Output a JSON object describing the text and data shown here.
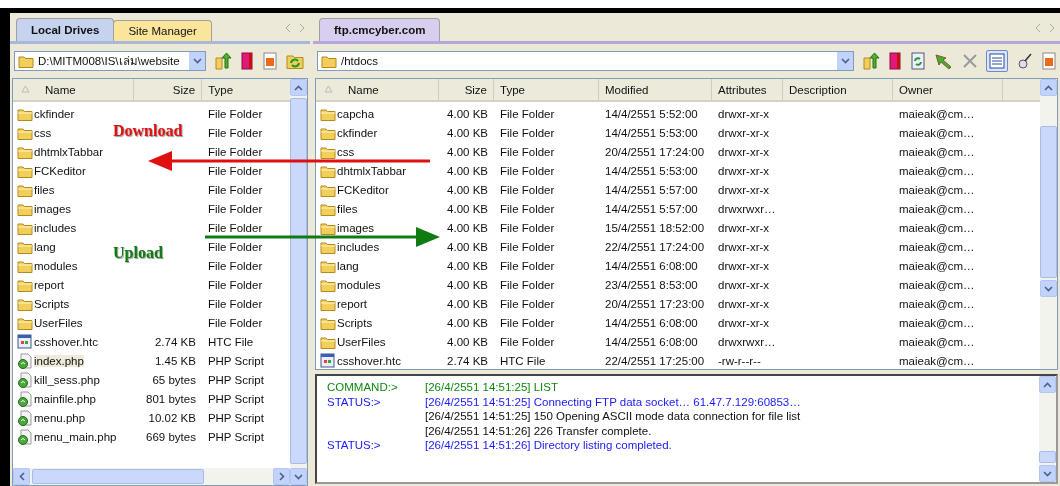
{
  "local": {
    "tabs": [
      {
        "label": "Local Drives",
        "selected": true
      },
      {
        "label": "Site Manager",
        "selected": false
      }
    ],
    "path": "D:\\MITM008\\IS\\เล่ม\\website",
    "columns": [
      "Name",
      "Size",
      "Type"
    ],
    "rows": [
      {
        "kind": "folder",
        "name": "ckfinder",
        "type": "File Folder",
        "selected": false
      },
      {
        "kind": "folder",
        "name": "css",
        "type": "File Folder",
        "selected": false
      },
      {
        "kind": "folder",
        "name": "dhtmlxTabbar",
        "type": "File Folder",
        "selected": false
      },
      {
        "kind": "folder",
        "name": "FCKeditor",
        "type": "File Folder",
        "selected": false
      },
      {
        "kind": "folder",
        "name": "files",
        "type": "File Folder",
        "selected": false
      },
      {
        "kind": "folder",
        "name": "images",
        "type": "File Folder",
        "selected": false
      },
      {
        "kind": "folder",
        "name": "includes",
        "type": "File Folder",
        "selected": false
      },
      {
        "kind": "folder",
        "name": "lang",
        "type": "File Folder",
        "selected": false
      },
      {
        "kind": "folder",
        "name": "modules",
        "type": "File Folder",
        "selected": false
      },
      {
        "kind": "folder",
        "name": "report",
        "type": "File Folder",
        "selected": false
      },
      {
        "kind": "folder",
        "name": "Scripts",
        "type": "File Folder",
        "selected": false
      },
      {
        "kind": "folder",
        "name": "UserFiles",
        "type": "File Folder",
        "selected": false
      },
      {
        "kind": "htc",
        "name": "csshover.htc",
        "size": "2.74 KB",
        "type": "HTC File",
        "selected": false
      },
      {
        "kind": "php",
        "name": "index.php",
        "size": "1.45 KB",
        "type": "PHP Script",
        "selected": true
      },
      {
        "kind": "php",
        "name": "kill_sess.php",
        "size": "65 bytes",
        "type": "PHP Script",
        "selected": false
      },
      {
        "kind": "php",
        "name": "mainfile.php",
        "size": "801 bytes",
        "type": "PHP Script",
        "selected": false
      },
      {
        "kind": "php",
        "name": "menu.php",
        "size": "10.02 KB",
        "type": "PHP Script",
        "selected": false
      },
      {
        "kind": "php",
        "name": "menu_main.php",
        "size": "669 bytes",
        "type": "PHP Script",
        "selected": false
      }
    ]
  },
  "remote": {
    "tabs": [
      {
        "label": "ftp.cmcyber.com",
        "selected": true
      }
    ],
    "path": "/htdocs",
    "columns": [
      "Name",
      "Size",
      "Type",
      "Modified",
      "Attributes",
      "Description",
      "Owner"
    ],
    "rows": [
      {
        "kind": "folder",
        "name": "capcha",
        "size": "4.00 KB",
        "type": "File Folder",
        "modified": "14/4/2551 5:52:00",
        "attributes": "drwxr-xr-x",
        "owner": "maieak@cm…"
      },
      {
        "kind": "folder",
        "name": "ckfinder",
        "size": "4.00 KB",
        "type": "File Folder",
        "modified": "14/4/2551 5:53:00",
        "attributes": "drwxr-xr-x",
        "owner": "maieak@cm…"
      },
      {
        "kind": "folder",
        "name": "css",
        "size": "4.00 KB",
        "type": "File Folder",
        "modified": "20/4/2551 17:24:00",
        "attributes": "drwxr-xr-x",
        "owner": "maieak@cm…"
      },
      {
        "kind": "folder",
        "name": "dhtmlxTabbar",
        "size": "4.00 KB",
        "type": "File Folder",
        "modified": "14/4/2551 5:53:00",
        "attributes": "drwxr-xr-x",
        "owner": "maieak@cm…"
      },
      {
        "kind": "folder",
        "name": "FCKeditor",
        "size": "4.00 KB",
        "type": "File Folder",
        "modified": "14/4/2551 5:57:00",
        "attributes": "drwxr-xr-x",
        "owner": "maieak@cm…"
      },
      {
        "kind": "folder",
        "name": "files",
        "size": "4.00 KB",
        "type": "File Folder",
        "modified": "14/4/2551 5:57:00",
        "attributes": "drwxrwxr…",
        "owner": "maieak@cm…"
      },
      {
        "kind": "folder",
        "name": "images",
        "size": "4.00 KB",
        "type": "File Folder",
        "modified": "15/4/2551 18:52:00",
        "attributes": "drwxr-xr-x",
        "owner": "maieak@cm…"
      },
      {
        "kind": "folder",
        "name": "includes",
        "size": "4.00 KB",
        "type": "File Folder",
        "modified": "22/4/2551 17:24:00",
        "attributes": "drwxr-xr-x",
        "owner": "maieak@cm…"
      },
      {
        "kind": "folder",
        "name": "lang",
        "size": "4.00 KB",
        "type": "File Folder",
        "modified": "14/4/2551 6:08:00",
        "attributes": "drwxr-xr-x",
        "owner": "maieak@cm…"
      },
      {
        "kind": "folder",
        "name": "modules",
        "size": "4.00 KB",
        "type": "File Folder",
        "modified": "23/4/2551 8:53:00",
        "attributes": "drwxr-xr-x",
        "owner": "maieak@cm…"
      },
      {
        "kind": "folder",
        "name": "report",
        "size": "4.00 KB",
        "type": "File Folder",
        "modified": "20/4/2551 17:23:00",
        "attributes": "drwxr-xr-x",
        "owner": "maieak@cm…"
      },
      {
        "kind": "folder",
        "name": "Scripts",
        "size": "4.00 KB",
        "type": "File Folder",
        "modified": "14/4/2551 6:08:00",
        "attributes": "drwxr-xr-x",
        "owner": "maieak@cm…"
      },
      {
        "kind": "folder",
        "name": "UserFiles",
        "size": "4.00 KB",
        "type": "File Folder",
        "modified": "14/4/2551 6:08:00",
        "attributes": "drwxrwxr…",
        "owner": "maieak@cm…"
      },
      {
        "kind": "htc",
        "name": "csshover.htc",
        "size": "2.74 KB",
        "type": "HTC File",
        "modified": "22/4/2551 17:25:00",
        "attributes": "-rw-r--r--",
        "owner": "maieak@cm…"
      }
    ]
  },
  "log": [
    {
      "kind": "command",
      "label": "COMMAND:>",
      "text": "[26/4/2551 14:51:25] LIST"
    },
    {
      "kind": "status",
      "label": "STATUS:>",
      "text": "[26/4/2551 14:51:25] Connecting FTP data socket… 61.47.7.129:60853…"
    },
    {
      "kind": "reply",
      "text": "[26/4/2551 14:51:25] 150 Opening ASCII mode data connection for file list"
    },
    {
      "kind": "reply",
      "text": "[26/4/2551 14:51:26] 226 Transfer complete."
    },
    {
      "kind": "status",
      "label": "STATUS:>",
      "text": "[26/4/2551 14:51:26] Directory listing completed."
    }
  ],
  "annotations": [
    {
      "kind": "download",
      "label": "Download"
    },
    {
      "kind": "upload",
      "label": "Upload"
    }
  ]
}
